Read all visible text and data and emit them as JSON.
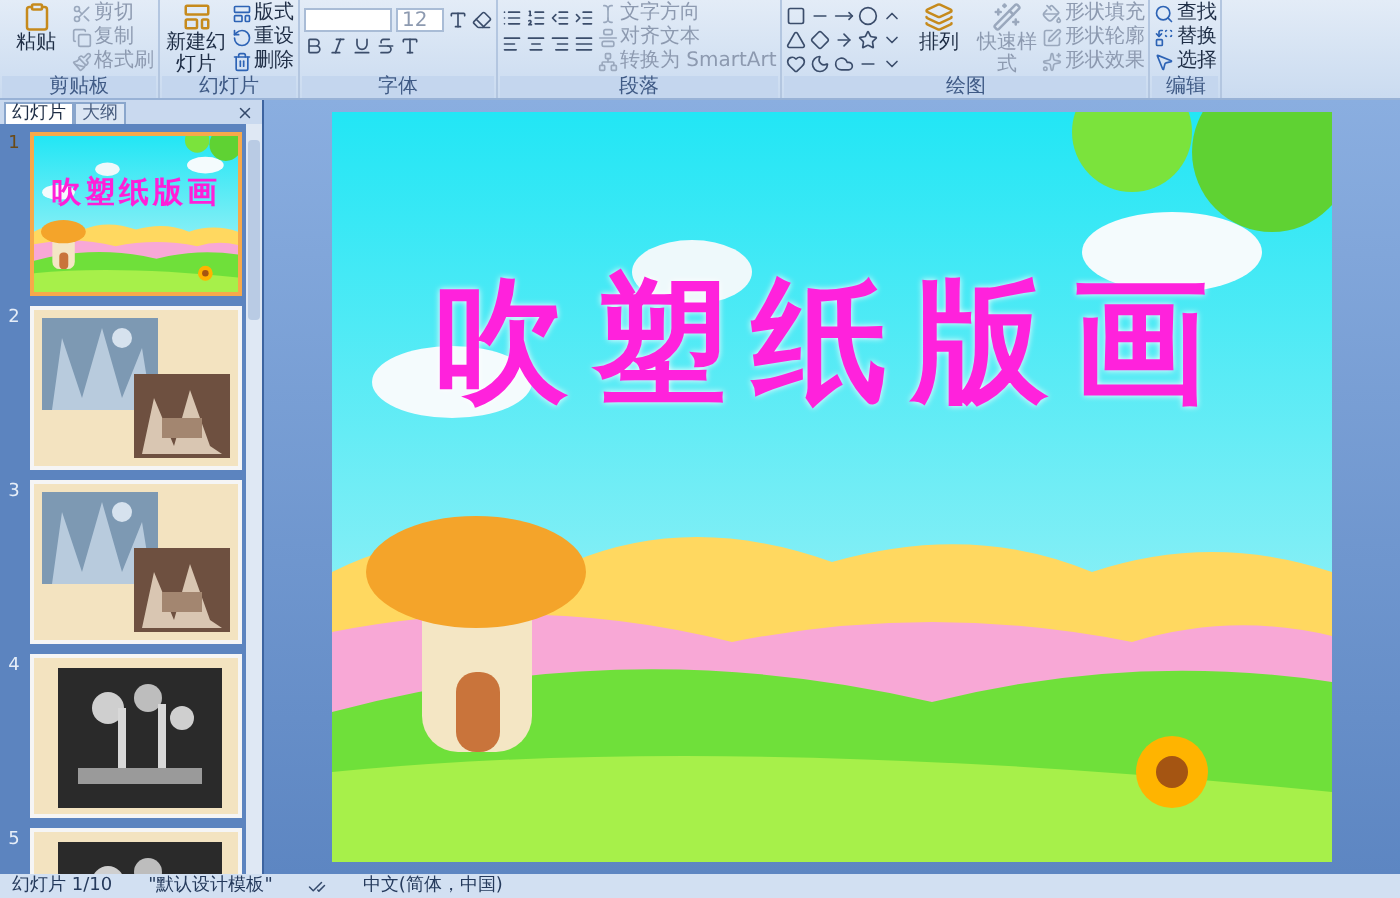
{
  "ribbon": {
    "groups": [
      {
        "label": "剪贴板",
        "kind": "plain",
        "buttons": [
          {
            "label": "粘贴",
            "large": true,
            "disabled": false
          },
          {
            "label": "剪切",
            "large": false,
            "disabled": true
          },
          {
            "label": "复制",
            "large": false,
            "disabled": true
          },
          {
            "label": "格式刷",
            "large": false,
            "disabled": true
          }
        ]
      },
      {
        "label": "幻灯片",
        "kind": "plain",
        "buttons": [
          {
            "label": "新建幻灯片",
            "large": true,
            "disabled": false
          },
          {
            "label": "版式",
            "large": false,
            "disabled": false
          },
          {
            "label": "重设",
            "large": false,
            "disabled": false
          },
          {
            "label": "删除",
            "large": false,
            "disabled": false
          }
        ]
      },
      {
        "label": "字体",
        "kind": "font",
        "font_size": "12"
      },
      {
        "label": "段落",
        "kind": "paragraph",
        "buttons": [
          {
            "label": "文字方向",
            "large": false,
            "disabled": true
          },
          {
            "label": "对齐文本",
            "large": false,
            "disabled": true
          },
          {
            "label": "转换为 SmartArt",
            "large": false,
            "disabled": true
          }
        ]
      },
      {
        "label": "绘图",
        "kind": "drawing",
        "buttons": [
          {
            "label": "排列",
            "large": true,
            "disabled": false
          },
          {
            "label": "快速样式",
            "large": true,
            "disabled": true
          },
          {
            "label": "形状填充",
            "large": false,
            "disabled": true
          },
          {
            "label": "形状轮廓",
            "large": false,
            "disabled": true
          },
          {
            "label": "形状效果",
            "large": false,
            "disabled": true
          }
        ]
      },
      {
        "label": "编辑",
        "kind": "plain",
        "buttons": [
          {
            "label": "查找",
            "large": false,
            "disabled": false
          },
          {
            "label": "替换",
            "large": false,
            "disabled": false
          },
          {
            "label": "选择",
            "large": false,
            "disabled": false
          }
        ]
      }
    ]
  },
  "slide_pane": {
    "tabs": [
      {
        "label": "幻灯片",
        "selected": true
      },
      {
        "label": "大纲",
        "selected": false
      }
    ],
    "slides": [
      {
        "number": "1",
        "selected": true,
        "kind": "title",
        "title": "吹塑纸版画"
      },
      {
        "number": "2",
        "selected": false,
        "kind": "two_photos"
      },
      {
        "number": "3",
        "selected": false,
        "kind": "two_photos"
      },
      {
        "number": "4",
        "selected": false,
        "kind": "one_photo"
      },
      {
        "number": "5",
        "selected": false,
        "kind": "one_photo"
      }
    ]
  },
  "slide": {
    "title": "吹塑纸版画"
  },
  "status_bar": {
    "slide_counter": "幻灯片 1/10",
    "theme": "\"默认设计模板\"",
    "language": "中文(简体，中国)"
  }
}
